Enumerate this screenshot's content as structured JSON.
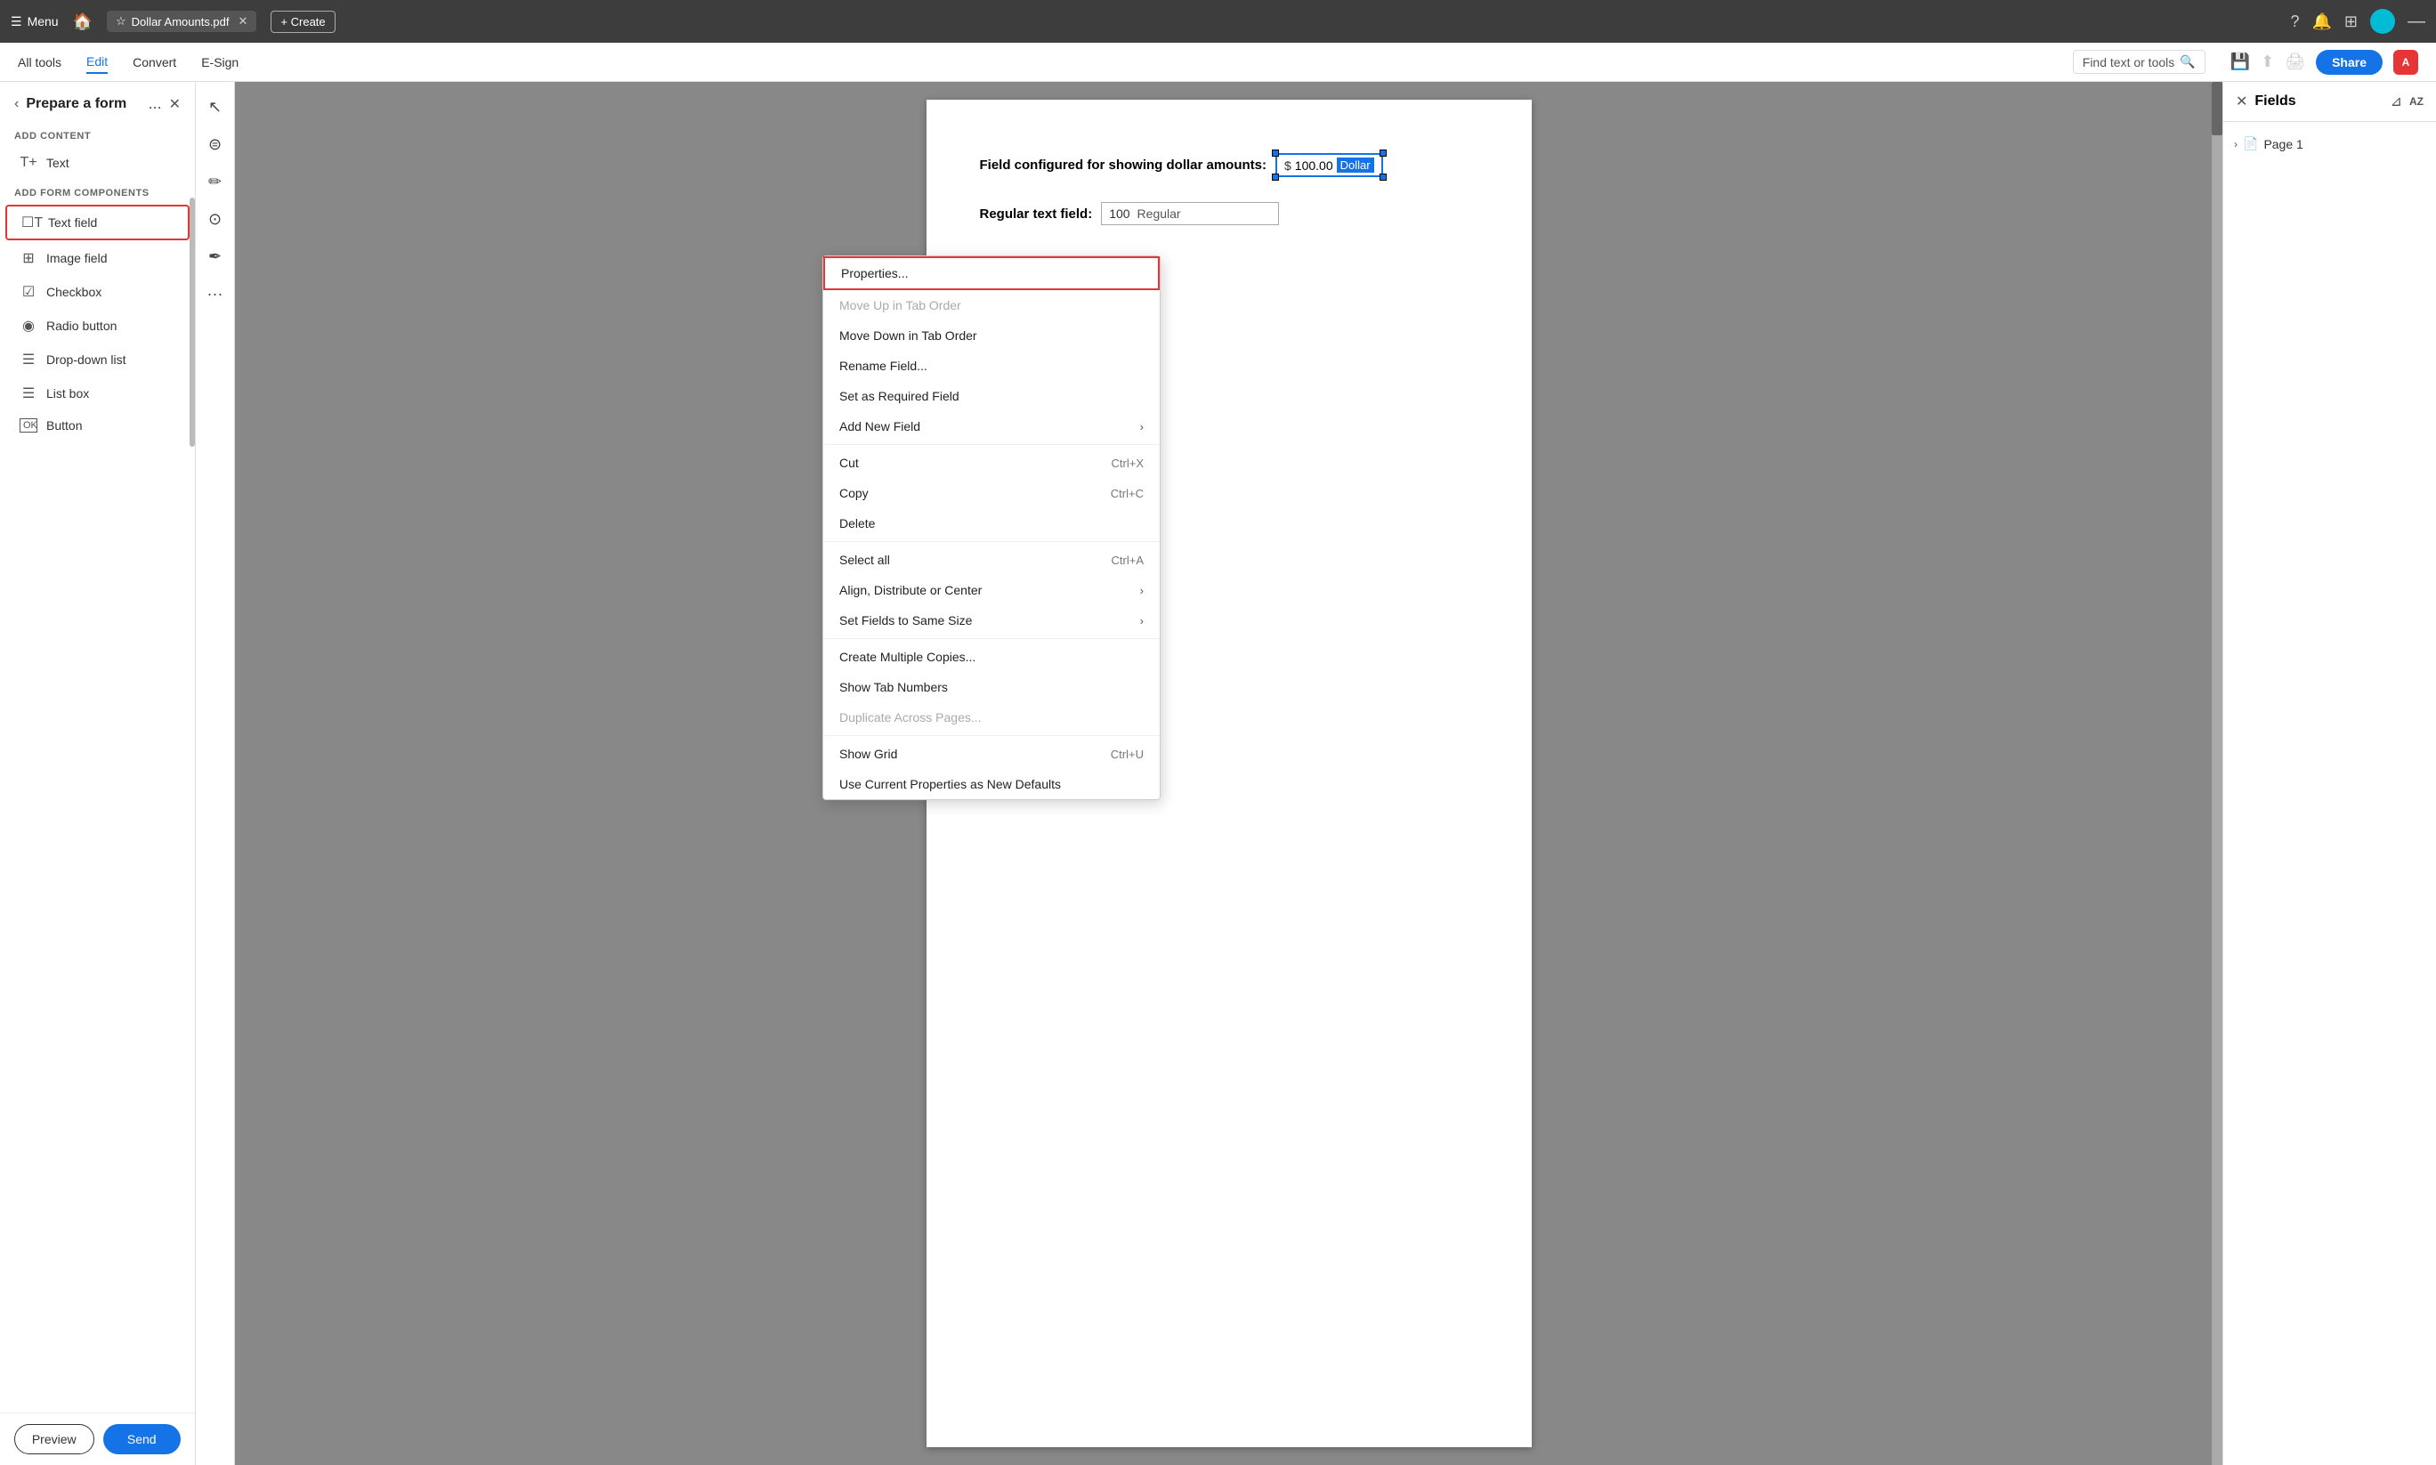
{
  "topBar": {
    "menuLabel": "Menu",
    "homeIcon": "🏠",
    "tabTitle": "Dollar Amounts.pdf",
    "tabCloseIcon": "✕",
    "createLabel": "+ Create",
    "helpIcon": "?",
    "bellIcon": "🔔",
    "gridIcon": "⊞",
    "minimizeIcon": "—"
  },
  "secondBar": {
    "navItems": [
      "All tools",
      "Edit",
      "Convert",
      "E-Sign"
    ],
    "activeNav": "Edit",
    "findPlaceholder": "Find text or tools",
    "shareLabel": "Share",
    "acrobatLabel": "A"
  },
  "sidebar": {
    "title": "Prepare a form",
    "backIcon": "‹",
    "moreIcon": "...",
    "closeIcon": "✕",
    "addContentLabel": "ADD CONTENT",
    "addFormLabel": "ADD FORM COMPONENTS",
    "contentItems": [
      {
        "id": "text",
        "icon": "T+",
        "label": "Text"
      }
    ],
    "formItems": [
      {
        "id": "text-field",
        "icon": "☐T",
        "label": "Text field",
        "highlighted": true
      },
      {
        "id": "image-field",
        "icon": "⊞",
        "label": "Image field"
      },
      {
        "id": "checkbox",
        "icon": "☑",
        "label": "Checkbox"
      },
      {
        "id": "radio-button",
        "icon": "◉",
        "label": "Radio button"
      },
      {
        "id": "dropdown-list",
        "icon": "☰",
        "label": "Drop-down list"
      },
      {
        "id": "list-box",
        "icon": "☰≡",
        "label": "List box"
      },
      {
        "id": "button",
        "icon": "OK",
        "label": "Button"
      }
    ],
    "previewLabel": "Preview",
    "sendLabel": "Send"
  },
  "toolbar": {
    "tools": [
      {
        "id": "select",
        "icon": "↖"
      },
      {
        "id": "search",
        "icon": "🔍"
      },
      {
        "id": "pen",
        "icon": "✏"
      },
      {
        "id": "link",
        "icon": "⊙"
      },
      {
        "id": "stamp",
        "icon": "✒"
      },
      {
        "id": "more",
        "icon": "···"
      }
    ]
  },
  "canvas": {
    "dollarFieldLabel": "Field configured for showing dollar amounts:",
    "dollarValue": "$ 100.00",
    "dollarTag": "Dollar",
    "regularFieldLabel": "Regular text field:",
    "regularValue": "100",
    "regularType": "Regular"
  },
  "rightPanel": {
    "title": "Fields",
    "closeIcon": "✕",
    "filterIcon": "⊿",
    "sortIcon": "AZ",
    "pageName": "Page 1",
    "pageIcon": "📄",
    "chevron": "›"
  },
  "contextMenu": {
    "items": [
      {
        "id": "properties",
        "label": "Properties...",
        "shortcut": "",
        "hasArrow": false,
        "highlighted": true,
        "disabled": false
      },
      {
        "id": "move-up",
        "label": "Move Up in Tab Order",
        "shortcut": "",
        "hasArrow": false,
        "highlighted": false,
        "disabled": true
      },
      {
        "id": "move-down",
        "label": "Move Down in Tab Order",
        "shortcut": "",
        "hasArrow": false,
        "highlighted": false,
        "disabled": false
      },
      {
        "id": "rename",
        "label": "Rename Field...",
        "shortcut": "",
        "hasArrow": false,
        "highlighted": false,
        "disabled": false
      },
      {
        "id": "required",
        "label": "Set as Required Field",
        "shortcut": "",
        "hasArrow": false,
        "highlighted": false,
        "disabled": false
      },
      {
        "id": "add-new-field",
        "label": "Add New Field",
        "shortcut": "",
        "hasArrow": true,
        "highlighted": false,
        "disabled": false
      },
      {
        "id": "cut",
        "label": "Cut",
        "shortcut": "Ctrl+X",
        "hasArrow": false,
        "highlighted": false,
        "disabled": false
      },
      {
        "id": "copy",
        "label": "Copy",
        "shortcut": "Ctrl+C",
        "hasArrow": false,
        "highlighted": false,
        "disabled": false
      },
      {
        "id": "delete",
        "label": "Delete",
        "shortcut": "",
        "hasArrow": false,
        "highlighted": false,
        "disabled": false
      },
      {
        "id": "select-all",
        "label": "Select all",
        "shortcut": "Ctrl+A",
        "hasArrow": false,
        "highlighted": false,
        "disabled": false
      },
      {
        "id": "align",
        "label": "Align, Distribute or Center",
        "shortcut": "",
        "hasArrow": true,
        "highlighted": false,
        "disabled": false
      },
      {
        "id": "same-size",
        "label": "Set Fields to Same Size",
        "shortcut": "",
        "hasArrow": true,
        "highlighted": false,
        "disabled": false
      },
      {
        "id": "multiple-copies",
        "label": "Create Multiple Copies...",
        "shortcut": "",
        "hasArrow": false,
        "highlighted": false,
        "disabled": false
      },
      {
        "id": "show-tab",
        "label": "Show Tab Numbers",
        "shortcut": "",
        "hasArrow": false,
        "highlighted": false,
        "disabled": false
      },
      {
        "id": "duplicate",
        "label": "Duplicate Across Pages...",
        "shortcut": "",
        "hasArrow": false,
        "highlighted": false,
        "disabled": true
      },
      {
        "id": "show-grid",
        "label": "Show Grid",
        "shortcut": "Ctrl+U",
        "hasArrow": false,
        "highlighted": false,
        "disabled": false
      },
      {
        "id": "use-current",
        "label": "Use Current Properties as New Defaults",
        "shortcut": "",
        "hasArrow": false,
        "highlighted": false,
        "disabled": false
      }
    ]
  }
}
